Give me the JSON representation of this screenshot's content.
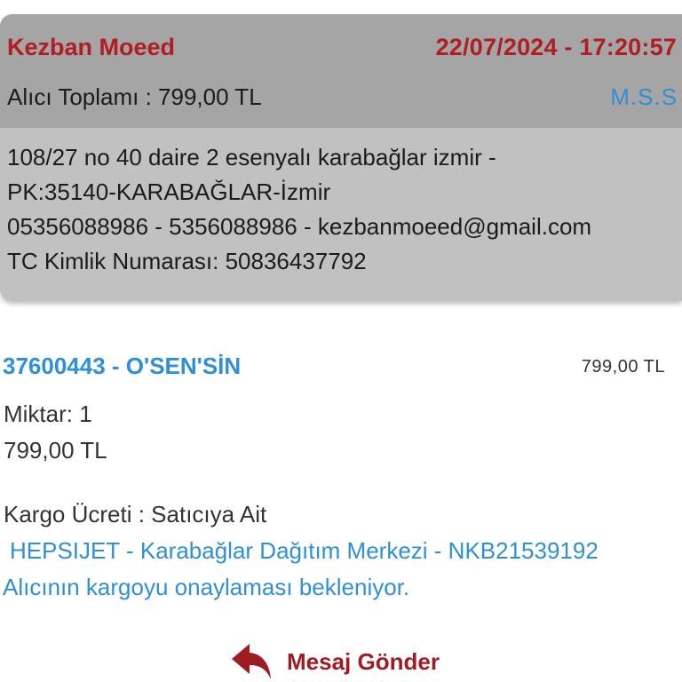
{
  "order": {
    "buyer_name": "Kezban Moeed",
    "datetime": "22/07/2024 - 17:20:57",
    "total_label": "Alıcı Toplamı : 799,00 TL",
    "store_link": "M.S.S",
    "address_line1": "108/27 no 40 daire 2 esenyalı karabağlar izmir -",
    "address_line2": "PK:35140-KARABAĞLAR-İzmir",
    "contact_line": "05356088986 - 5356088986 - kezbanmoeed@gmail.com",
    "tc_line": "TC Kimlik Numarası: 50836437792"
  },
  "product": {
    "title": "37600443 - O'SEN'SİN",
    "price": "799,00 TL",
    "quantity": "Miktar: 1",
    "unit_price": "799,00 TL",
    "cargo_fee": "Kargo Ücreti :  Satıcıya Ait",
    "shipping_info": "HEPSIJET - Karabağlar Dağıtım Merkezi - NKB21539192",
    "status": "Alıcının kargoyu onaylaması bekleniyor."
  },
  "actions": {
    "message_label": "Mesaj Gönder",
    "message_icon": "reply-arrow-icon",
    "accent_color": "#9e1c22"
  },
  "colors": {
    "header_name": "#b01e23",
    "link_blue": "#2f8fd8",
    "card_header_bg": "#a5a5a5",
    "card_body_bg": "#c1c1c1"
  }
}
